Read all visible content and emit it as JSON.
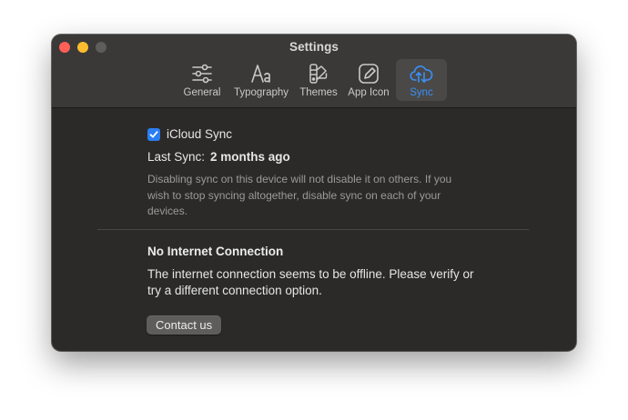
{
  "window": {
    "title": "Settings"
  },
  "tabs": [
    {
      "label": "General",
      "icon": "sliders-icon",
      "active": false
    },
    {
      "label": "Typography",
      "icon": "typography-icon",
      "active": false
    },
    {
      "label": "Themes",
      "icon": "swatches-icon",
      "active": false
    },
    {
      "label": "App Icon",
      "icon": "app-icon-icon",
      "active": false
    },
    {
      "label": "Sync",
      "icon": "cloud-sync-icon",
      "active": true
    }
  ],
  "sync": {
    "checkbox_label": "iCloud Sync",
    "checked": true,
    "last_sync_label": "Last Sync:",
    "last_sync_value": "2 months ago",
    "description": "Disabling sync on this device will not disable it on others. If you wish to stop syncing altogether, disable sync on each of your devices."
  },
  "connection": {
    "heading": "No Internet Connection",
    "message": "The internet connection seems to be offline. Please verify or try a different connection option.",
    "contact_label": "Contact us"
  },
  "colors": {
    "accent": "#3a8ff5",
    "checkbox": "#2a7ef1",
    "window_bg": "#2b2a29",
    "titlebar_bg": "#3a3938",
    "close": "#fe5f57",
    "minimize": "#febc2e",
    "zoom_disabled": "#5d5d5d"
  }
}
